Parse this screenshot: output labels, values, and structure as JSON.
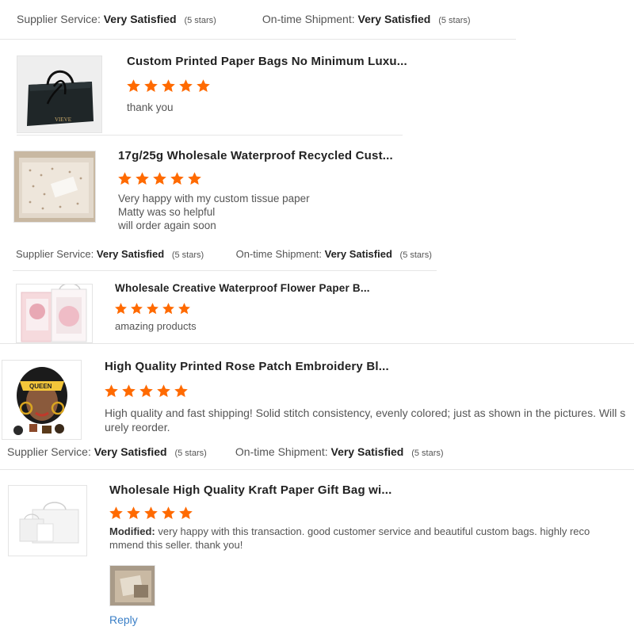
{
  "rating_label_supplier": "Supplier Service:",
  "rating_label_shipment": "On-time Shipment:",
  "rating_value": "Very Satisfied",
  "rating_count": "(5 stars)",
  "accent_star_color": "#ff6a00",
  "link_color": "#3a7fc7",
  "reviews": [
    {
      "title": "Custom Printed Paper Bags No Minimum Luxu...",
      "stars": 5,
      "text": "thank you",
      "image_label": "VIEVE"
    },
    {
      "title": "17g/25g Wholesale Waterproof Recycled Cust...",
      "stars": 5,
      "text_lines": [
        "Very happy with my custom tissue paper",
        "Matty was so helpful",
        "will order again soon"
      ]
    },
    {
      "title": "Wholesale Creative Waterproof Flower Paper B...",
      "stars": 5,
      "text": "amazing products"
    },
    {
      "title": "High Quality Printed Rose Patch Embroidery Bl...",
      "stars": 5,
      "text_lines": [
        "High quality and fast shipping! Solid stitch consistency, evenly colored; just as shown in the pictures. Will s",
        "urely reorder."
      ],
      "image_label": "QUEEN"
    },
    {
      "title": "Wholesale High Quality Kraft Paper Gift Bag wi...",
      "stars": 5,
      "modified_label": "Modified:",
      "text_lines": [
        "very happy with this transaction.  good customer service and beautiful custom bags.  highly reco",
        "mmend this seller. thank you!"
      ],
      "reply": "Reply"
    }
  ]
}
